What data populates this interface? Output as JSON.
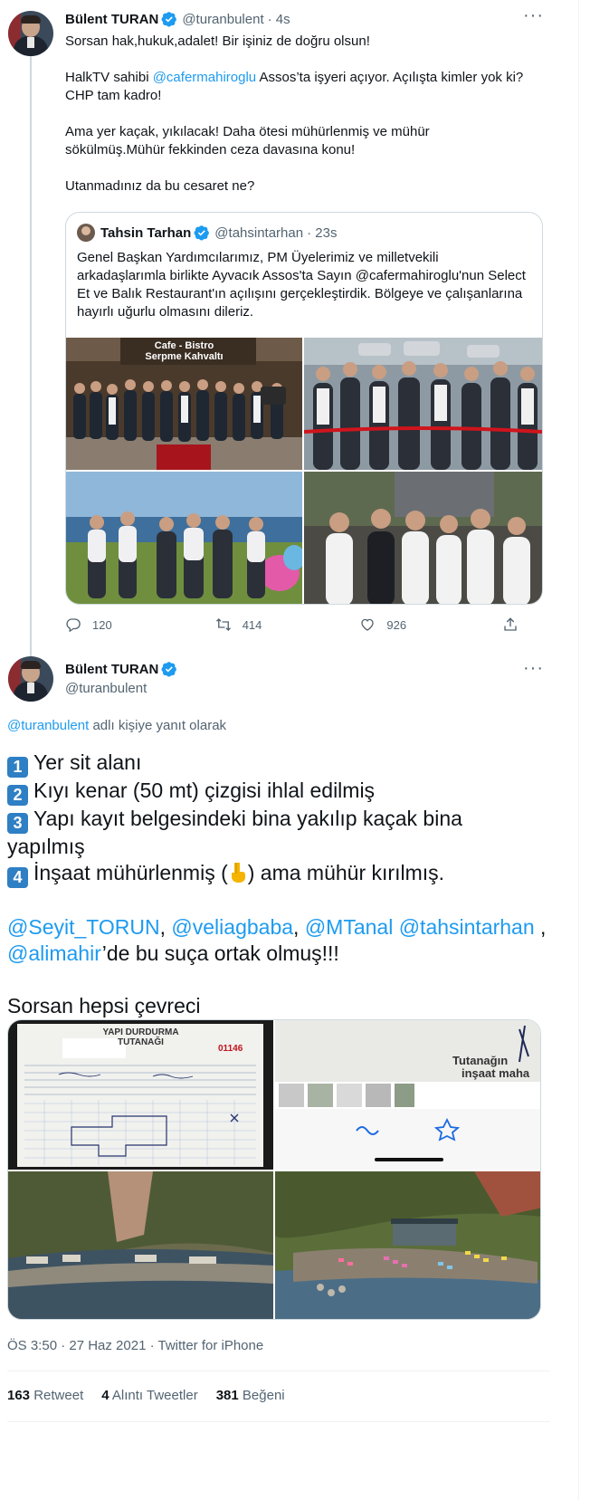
{
  "thread": {
    "author": {
      "name": "Bülent TURAN",
      "handle": "@turanbulent",
      "time": "· 4s"
    },
    "text": {
      "p1": "Sorsan hak,hukuk,adalet! Bir işiniz de doğru olsun!",
      "p2_pre": "HalkTV sahibi ",
      "p2_mention": "@cafermahiroglu",
      "p2_post": " Assos’ta işyeri açıyor. Açılışta kimler yok ki? CHP tam kadro!",
      "p3": "Ama yer kaçak, yıkılacak! Daha ötesi mühürlenmiş ve mühür sökülmüş.Mühür fekkinden ceza davasına konu!",
      "p4": "Utanmadınız da bu cesaret ne?"
    },
    "quote": {
      "name": "Tahsin Tarhan",
      "handle": "@tahsintarhan",
      "time": "· 23s",
      "text": "Genel Başkan Yardımcılarımız, PM Üyelerimiz ve milletvekili arkadaşlarımla birlikte Ayvacık Assos'ta Sayın @cafermahiroglu'nun Select Et ve Balık Restaurant'ın açılışını gerçekleştirdik. Bölgeye ve çalışanlarına hayırlı uğurlu olmasını dileriz.",
      "sign_line1": "Cafe - Bistro",
      "sign_line2": "Serpme Kahvaltı"
    },
    "actions": {
      "reply_count": "120",
      "retweet_count": "414",
      "like_count": "926"
    }
  },
  "main": {
    "author": {
      "name": "Bülent TURAN",
      "handle": "@turanbulent"
    },
    "reply_to": {
      "mention": "@turanbulent",
      "suffix": " adlı kişiye yanıt olarak"
    },
    "items": [
      {
        "key": "1",
        "text": "Yer sit alanı"
      },
      {
        "key": "2",
        "text": "Kıyı kenar (50 mt) çizgisi ihlal edilmiş"
      },
      {
        "key": "3",
        "text": "Yapı kayıt belgesindeki bina yakılıp kaçak  bina yapılmış"
      },
      {
        "key": "4",
        "text_pre": "İnşaat mühürlenmiş (",
        "text_post": ") ama mühür kırılmış."
      }
    ],
    "mentions": {
      "m1": "@Seyit_TORUN",
      "m2": "@veliagbaba",
      "m3": "@MTanal",
      "m4": "@tahsintarhan",
      "m5": "@alimahir",
      "tail": "’de bu suça ortak olmuş!!!"
    },
    "closing": "Sorsan hepsi çevreci",
    "doc": {
      "header1": "YAPI DURDURMA",
      "header2": "TUTANAĞI",
      "number": "01146",
      "right_top1": "Tutanağın",
      "right_top2": "inşaat maha"
    },
    "meta": "ÖS 3:50 · 27 Haz 2021 · Twitter for iPhone",
    "stats": {
      "retweets_num": "163",
      "retweets_label": "Retweet",
      "quotes_num": "4",
      "quotes_label": "Alıntı Tweetler",
      "likes_num": "381",
      "likes_label": "Beğeni"
    }
  },
  "colors": {
    "link": "#1d9bf0",
    "secondary": "#536471",
    "border": "#cfd9de",
    "keycap": "#2f7fc4"
  }
}
